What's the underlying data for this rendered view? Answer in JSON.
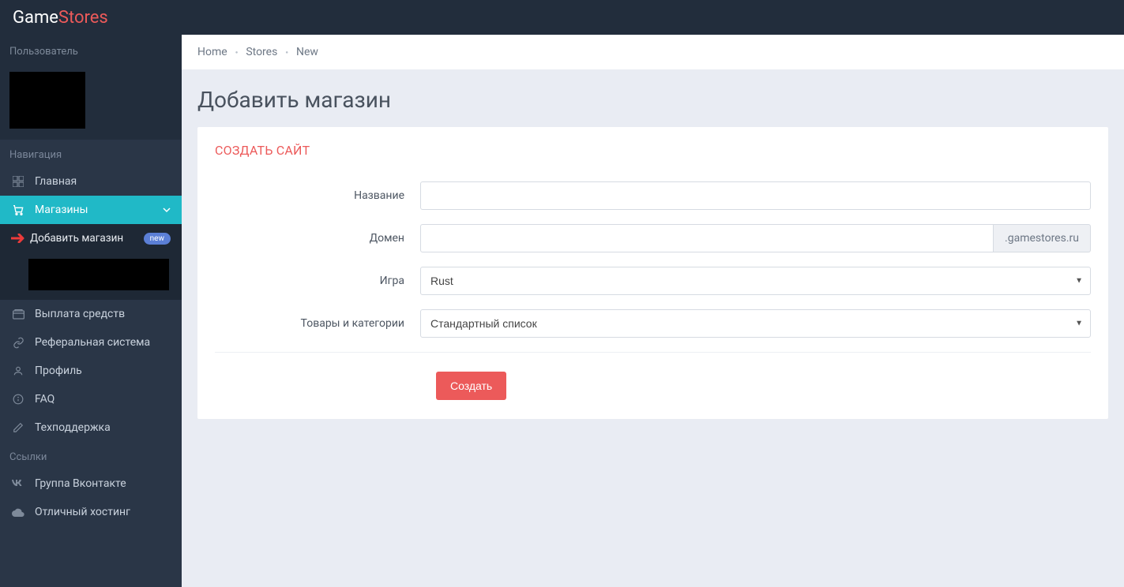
{
  "brand": {
    "a": "Game",
    "b": "Stores"
  },
  "sidebar": {
    "user_head": "Пользователь",
    "nav_head": "Навигация",
    "links_head": "Ссылки",
    "home": "Главная",
    "stores": "Магазины",
    "add_store": "Добавить магазин",
    "add_badge": "new",
    "payout": "Выплата средств",
    "referral": "Реферальная система",
    "profile": "Профиль",
    "faq": "FAQ",
    "support": "Техподдержка",
    "vk": "Группа Вконтакте",
    "hosting": "Отличный хостинг"
  },
  "breadcrumbs": {
    "a": "Home",
    "b": "Stores",
    "c": "New"
  },
  "page": {
    "title": "Добавить магазин",
    "card_title": "СОЗДАТЬ САЙТ",
    "labels": {
      "name": "Название",
      "domain": "Домен",
      "game": "Игра",
      "goods": "Товары и категории"
    },
    "domain_suffix": ".gamestores.ru",
    "game_value": "Rust",
    "goods_value": "Стандартный список",
    "submit": "Создать"
  }
}
